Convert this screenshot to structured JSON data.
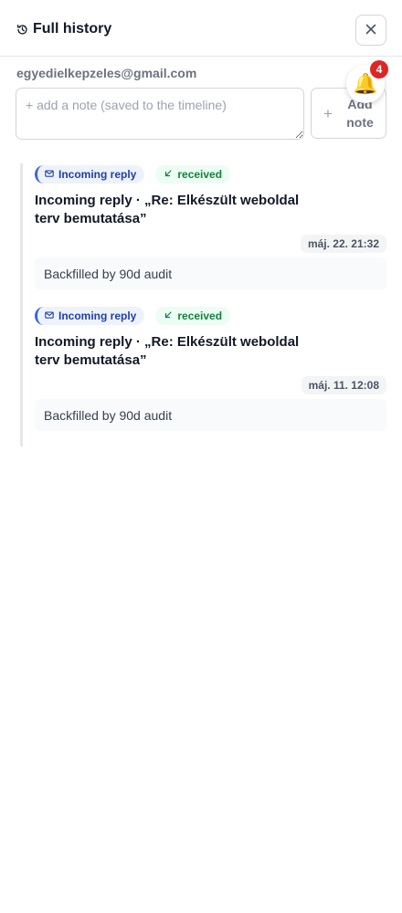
{
  "header": {
    "title": "Full history",
    "close_label": "×"
  },
  "contact": {
    "email": "egyedielkepzeles@gmail.com"
  },
  "composer": {
    "placeholder": "+ add a note (saved to the timeline)",
    "value": "",
    "add_button": "Add note",
    "plus": "+"
  },
  "notifications": {
    "count": "4",
    "icon": "bell-icon"
  },
  "entries": [
    {
      "type_badge": "Incoming reply",
      "status_badge": "received",
      "title": "Incoming reply · „Re: Elkészült weboldal terv bemutatása”",
      "date": "máj. 22. 21:32",
      "note": "Backfilled by 90d audit"
    },
    {
      "type_badge": "Incoming reply",
      "status_badge": "received",
      "title": "Incoming reply · „Re: Elkészült weboldal terv bemutatása”",
      "date": "máj. 11. 12:08",
      "note": "Backfilled by 90d audit"
    }
  ],
  "colors": {
    "accent": "#3b64d8",
    "received": "#15803d",
    "badge": "#dc2626"
  }
}
